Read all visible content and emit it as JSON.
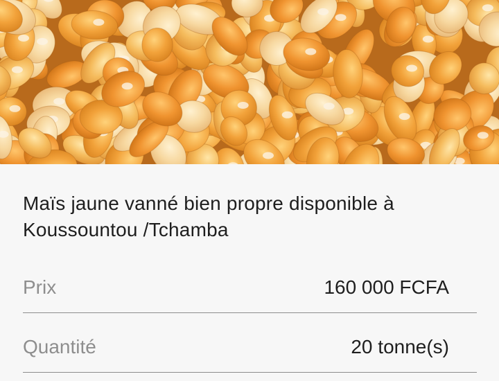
{
  "listing": {
    "title": "Maïs jaune vanné bien propre disponible à Koussountou /Tchamba",
    "image_alt": "maize-kernels-photo",
    "details": [
      {
        "label": "Prix",
        "value": "160 000 FCFA"
      },
      {
        "label": "Quantité",
        "value": "20 tonne(s)"
      }
    ]
  },
  "colors": {
    "text": "#1e1e1e",
    "label": "#8e8e8e",
    "divider": "#8c8c8c",
    "background": "#f7f7f7"
  }
}
